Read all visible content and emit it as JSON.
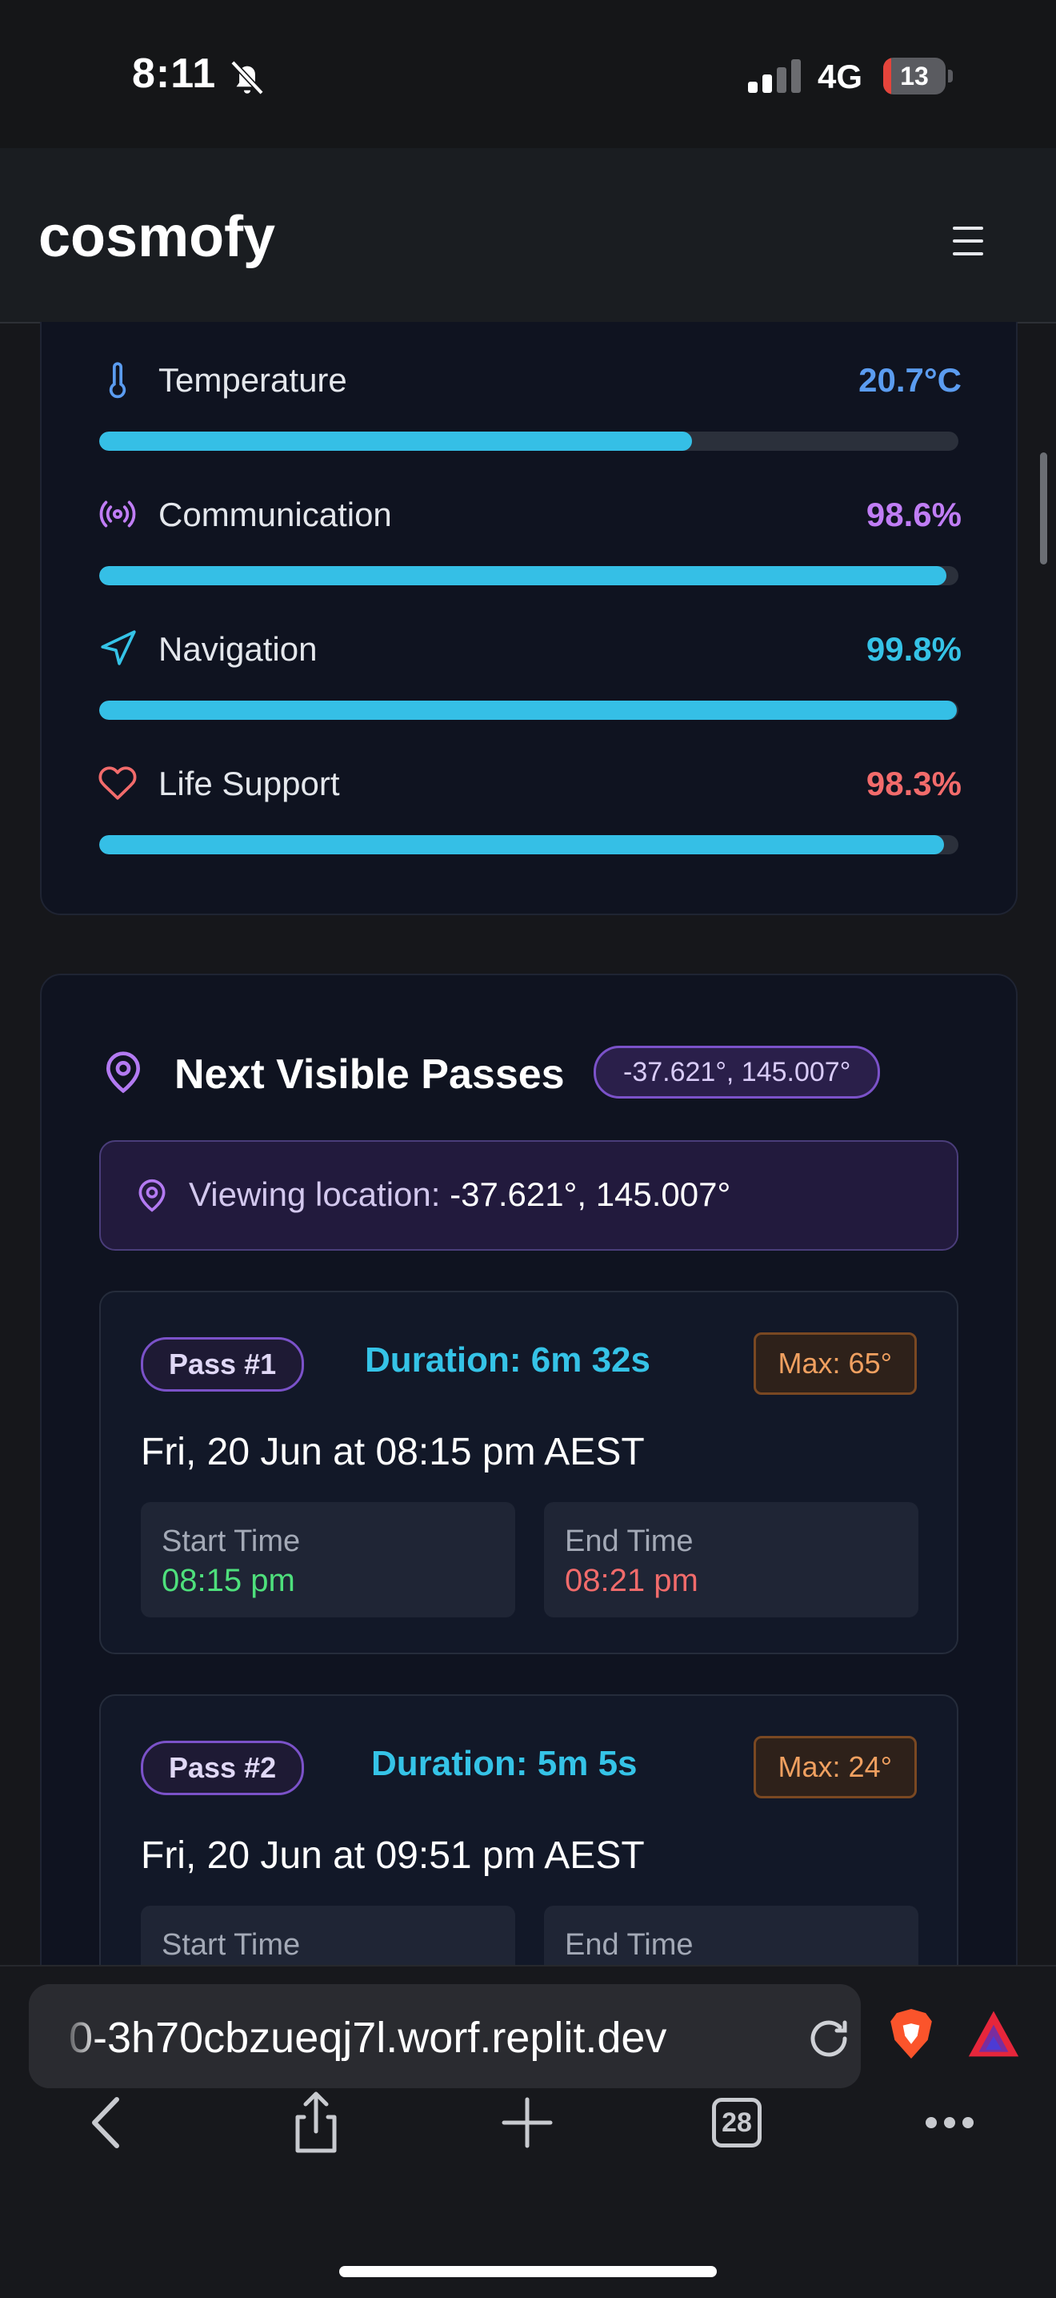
{
  "status_bar": {
    "time": "8:11",
    "network": "4G",
    "battery": "13",
    "battery_level": 0.13
  },
  "header": {
    "brand": "cosmofy"
  },
  "systems": [
    {
      "label": "Temperature",
      "value": "20.7°C",
      "level": 0.69,
      "color": "#5b9cf0",
      "icon": "thermometer-icon"
    },
    {
      "label": "Communication",
      "value": "98.6%",
      "level": 0.986,
      "color": "#c07df5",
      "icon": "radio-icon"
    },
    {
      "label": "Navigation",
      "value": "99.8%",
      "level": 0.998,
      "color": "#35c3e7",
      "icon": "navigation-icon"
    },
    {
      "label": "Life Support",
      "value": "98.3%",
      "level": 0.983,
      "color": "#f26b6b",
      "icon": "heart-icon"
    }
  ],
  "passes_section": {
    "title": "Next Visible Passes",
    "coords_badge": "-37.621°, 145.007°",
    "viewing_label": "Viewing location:",
    "viewing_value": "-37.621°, 145.007°",
    "start_label": "Start Time",
    "end_label": "End Time",
    "passes": [
      {
        "badge": "Pass #1",
        "duration": "Duration: 6m 32s",
        "max": "Max: 65°",
        "date": "Fri, 20 Jun at 08:15 pm AEST",
        "start": "08:15 pm",
        "end": "08:21 pm"
      },
      {
        "badge": "Pass #2",
        "duration": "Duration: 5m 5s",
        "max": "Max: 24°",
        "date": "Fri, 20 Jun at 09:51 pm AEST",
        "start": "",
        "end": ""
      }
    ]
  },
  "browser": {
    "url": "0-3h70cbzueqj7l.worf.replit.dev",
    "tabs_count": "28"
  }
}
